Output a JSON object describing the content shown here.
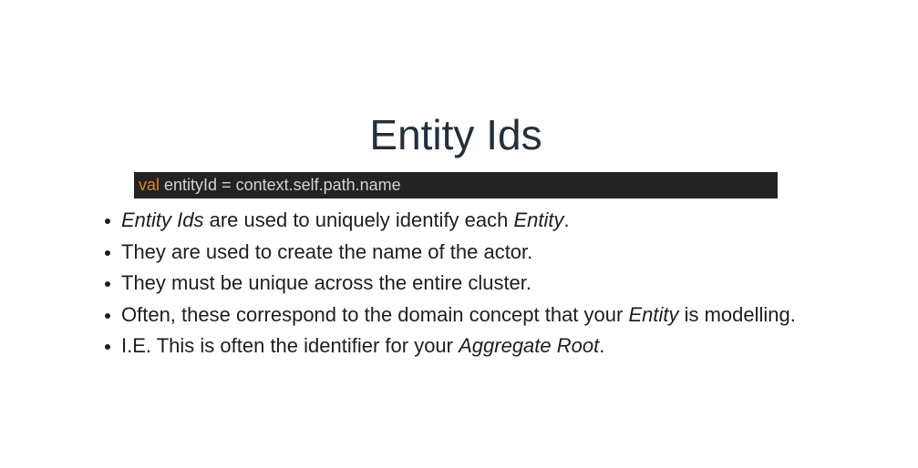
{
  "slide": {
    "title": "Entity Ids",
    "code": {
      "keyword": "val",
      "rest": " entityId = context.self.path.name"
    },
    "bullets": [
      {
        "parts": [
          {
            "text": "Entity Ids",
            "italic": true
          },
          {
            "text": " are used to uniquely identify each "
          },
          {
            "text": "Entity",
            "italic": true
          },
          {
            "text": "."
          }
        ]
      },
      {
        "parts": [
          {
            "text": "They are used to create the name of the actor."
          }
        ]
      },
      {
        "parts": [
          {
            "text": "They must be unique across the entire cluster."
          }
        ]
      },
      {
        "parts": [
          {
            "text": "Often, these correspond to the domain concept that your "
          },
          {
            "text": "Entity",
            "italic": true
          },
          {
            "text": " is modelling."
          }
        ]
      },
      {
        "parts": [
          {
            "text": "I.E. This is often the identifier for your "
          },
          {
            "text": "Aggregate Root",
            "italic": true
          },
          {
            "text": "."
          }
        ]
      }
    ]
  }
}
